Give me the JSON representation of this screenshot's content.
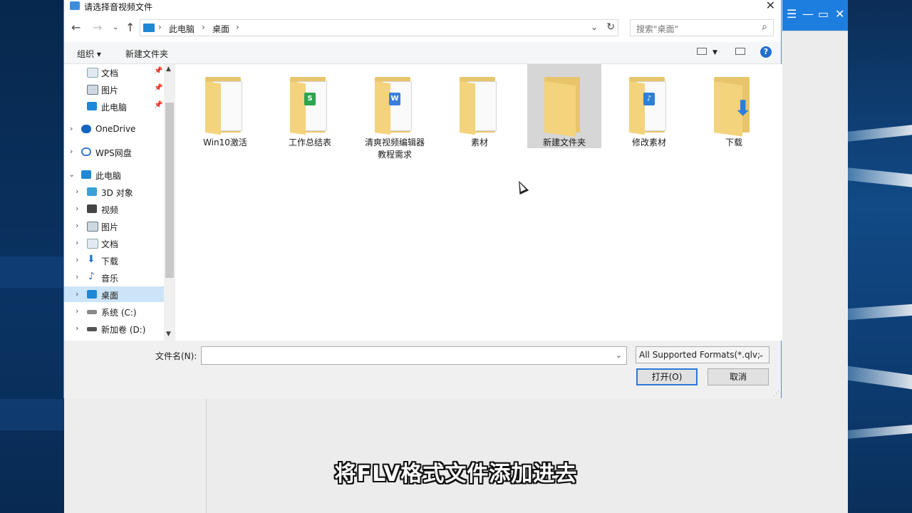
{
  "dialog": {
    "title": "请选择音视频文件",
    "close": "✕",
    "breadcrumb": [
      "此电脑",
      "桌面"
    ],
    "search_placeholder": "搜索\"桌面\"",
    "organize": "组织",
    "new_folder": "新建文件夹",
    "help": "?",
    "file_name_label": "文件名(N):",
    "file_name_value": "",
    "file_type": "All Supported Formats(*.qlv;",
    "open_button": "打开(O)",
    "cancel_button": "取消"
  },
  "nav": {
    "items": [
      {
        "label": "文档",
        "pinned": true
      },
      {
        "label": "图片",
        "pinned": true
      },
      {
        "label": "此电脑",
        "pinned": true
      },
      {
        "label": "OneDrive"
      },
      {
        "label": "WPS网盘"
      },
      {
        "label": "此电脑",
        "expanded": true
      },
      {
        "label": "3D 对象"
      },
      {
        "label": "视频"
      },
      {
        "label": "图片"
      },
      {
        "label": "文档"
      },
      {
        "label": "下载"
      },
      {
        "label": "音乐"
      },
      {
        "label": "桌面",
        "selected": true
      },
      {
        "label": "系统 (C:)"
      },
      {
        "label": "新加卷 (D:)"
      }
    ]
  },
  "files": [
    {
      "name": "Win10激活",
      "icon": "folder-docs"
    },
    {
      "name": "工作总结表",
      "icon": "folder-spreadsheet"
    },
    {
      "name": "清爽视频编辑器教程需求",
      "icon": "folder-word"
    },
    {
      "name": "素材",
      "icon": "folder-images"
    },
    {
      "name": "新建文件夹",
      "icon": "folder-empty",
      "selected": true
    },
    {
      "name": "修改素材",
      "icon": "folder-audio"
    },
    {
      "name": "下载",
      "icon": "folder-download"
    }
  ],
  "caption": "将FLV格式文件添加进去",
  "colors": {
    "accent": "#1e7ee0",
    "selection": "#cce4f7"
  }
}
